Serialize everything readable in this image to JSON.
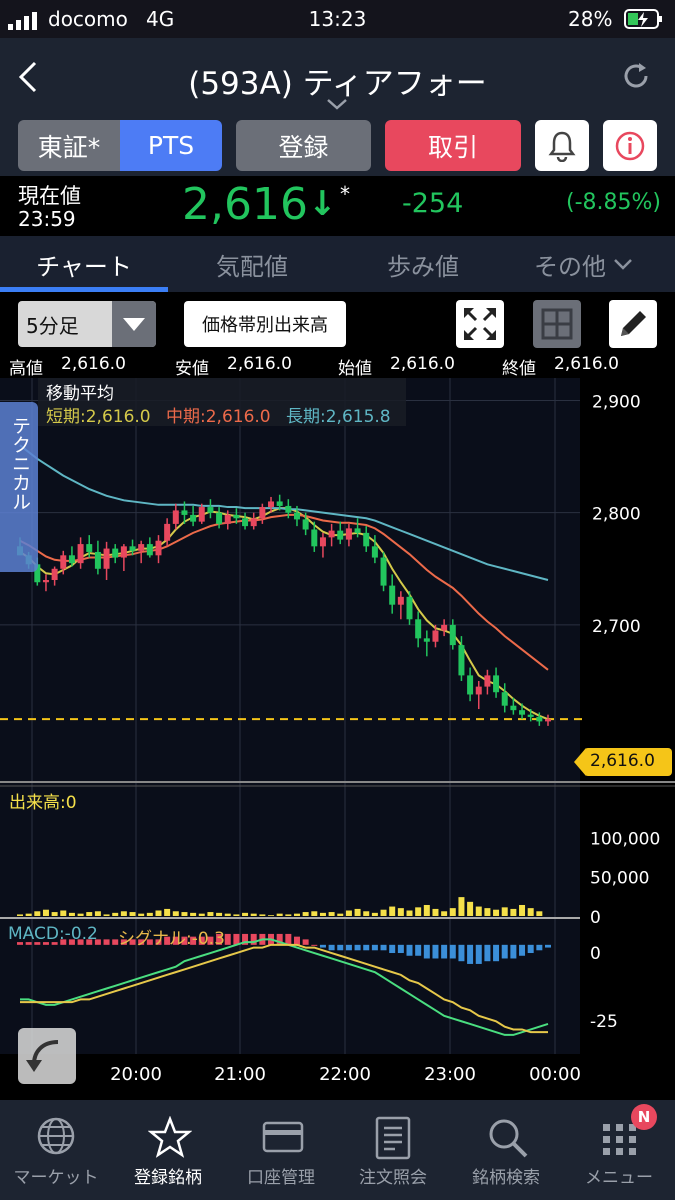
{
  "status_bar": {
    "carrier": "docomo",
    "network": "4G",
    "time": "13:23",
    "battery": "28%"
  },
  "header": {
    "title": "(593A) ティアフォー"
  },
  "buttons": {
    "tse": "東証*",
    "pts": "PTS",
    "register": "登録",
    "trade": "取引"
  },
  "price": {
    "label": "現在値",
    "time": "23:59",
    "value": "2,616",
    "direction": "↓",
    "mark": "*",
    "change": "-254",
    "change_pct": "(-8.85%)",
    "colors": {
      "value": "#22c55e",
      "change": "#22c55e"
    }
  },
  "tabs": [
    {
      "label": "チャート",
      "active": true
    },
    {
      "label": "気配値",
      "active": false
    },
    {
      "label": "歩み値",
      "active": false
    },
    {
      "label": "その他",
      "active": false
    }
  ],
  "chart_toolbar": {
    "interval": "5分足",
    "volume_profile_label": "価格帯別出来高"
  },
  "ohlc": {
    "high_label": "高値",
    "high": "2,616.0",
    "low_label": "安値",
    "low": "2,616.0",
    "open_label": "始値",
    "open": "2,616.0",
    "close_label": "終値",
    "close": "2,616.0"
  },
  "moving_avg": {
    "title": "移動平均",
    "short": "短期:2,616.0",
    "mid": "中期:2,616.0",
    "long": "長期:2,615.8",
    "colors": {
      "short": "#d4c94a",
      "mid": "#ec6a4a",
      "long": "#5fb6c4"
    }
  },
  "technical_tab": "テクニカル",
  "volume_label": "出来高:0",
  "macd": {
    "macd_label": "MACD:-0.2",
    "signal_label": "シグナル:-0.3"
  },
  "current_price_tag": "2,616.0",
  "chart_data": [
    {
      "type": "candlestick",
      "ylim": [
        2560,
        2920
      ],
      "yticks": [
        "2,900",
        "2,800",
        "2,700"
      ],
      "x_ticks": [
        "20:00",
        "21:00",
        "22:00",
        "23:00",
        "00:00"
      ],
      "current_price": 2616,
      "candles": [
        [
          2770,
          2778,
          2762,
          2762
        ],
        [
          2762,
          2765,
          2750,
          2754
        ],
        [
          2754,
          2760,
          2735,
          2738
        ],
        [
          2738,
          2745,
          2730,
          2740
        ],
        [
          2740,
          2752,
          2735,
          2750
        ],
        [
          2750,
          2766,
          2745,
          2762
        ],
        [
          2762,
          2770,
          2752,
          2755
        ],
        [
          2755,
          2778,
          2750,
          2772
        ],
        [
          2772,
          2780,
          2760,
          2765
        ],
        [
          2765,
          2775,
          2745,
          2750
        ],
        [
          2750,
          2774,
          2740,
          2768
        ],
        [
          2768,
          2772,
          2755,
          2760
        ],
        [
          2760,
          2772,
          2748,
          2770
        ],
        [
          2770,
          2776,
          2762,
          2766
        ],
        [
          2766,
          2775,
          2755,
          2772
        ],
        [
          2772,
          2778,
          2760,
          2762
        ],
        [
          2762,
          2780,
          2755,
          2775
        ],
        [
          2775,
          2795,
          2770,
          2790
        ],
        [
          2790,
          2808,
          2785,
          2802
        ],
        [
          2802,
          2810,
          2790,
          2798
        ],
        [
          2798,
          2806,
          2788,
          2792
        ],
        [
          2792,
          2808,
          2790,
          2805
        ],
        [
          2805,
          2812,
          2795,
          2800
        ],
        [
          2800,
          2805,
          2786,
          2790
        ],
        [
          2790,
          2802,
          2785,
          2798
        ],
        [
          2798,
          2804,
          2790,
          2795
        ],
        [
          2795,
          2800,
          2785,
          2788
        ],
        [
          2788,
          2800,
          2785,
          2795
        ],
        [
          2795,
          2808,
          2790,
          2805
        ],
        [
          2805,
          2814,
          2800,
          2810
        ],
        [
          2810,
          2816,
          2802,
          2806
        ],
        [
          2806,
          2812,
          2795,
          2800
        ],
        [
          2800,
          2806,
          2788,
          2794
        ],
        [
          2794,
          2800,
          2780,
          2785
        ],
        [
          2785,
          2792,
          2765,
          2770
        ],
        [
          2770,
          2782,
          2760,
          2778
        ],
        [
          2778,
          2790,
          2770,
          2784
        ],
        [
          2784,
          2792,
          2772,
          2776
        ],
        [
          2776,
          2790,
          2770,
          2786
        ],
        [
          2786,
          2795,
          2778,
          2782
        ],
        [
          2782,
          2788,
          2765,
          2770
        ],
        [
          2770,
          2780,
          2755,
          2760
        ],
        [
          2760,
          2765,
          2730,
          2735
        ],
        [
          2735,
          2745,
          2710,
          2718
        ],
        [
          2718,
          2730,
          2705,
          2725
        ],
        [
          2725,
          2730,
          2700,
          2705
        ],
        [
          2705,
          2712,
          2680,
          2688
        ],
        [
          2688,
          2695,
          2672,
          2685
        ],
        [
          2685,
          2700,
          2680,
          2695
        ],
        [
          2695,
          2705,
          2690,
          2700
        ],
        [
          2700,
          2705,
          2678,
          2682
        ],
        [
          2682,
          2690,
          2650,
          2655
        ],
        [
          2655,
          2662,
          2632,
          2638
        ],
        [
          2638,
          2650,
          2625,
          2645
        ],
        [
          2645,
          2660,
          2638,
          2655
        ],
        [
          2655,
          2662,
          2635,
          2640
        ],
        [
          2640,
          2648,
          2622,
          2628
        ],
        [
          2628,
          2635,
          2620,
          2624
        ],
        [
          2624,
          2630,
          2616,
          2620
        ],
        [
          2620,
          2625,
          2614,
          2618
        ],
        [
          2618,
          2622,
          2610,
          2614
        ],
        [
          2614,
          2620,
          2610,
          2616
        ]
      ],
      "series": [
        {
          "name": "短期",
          "values": [
            2765,
            2760,
            2752,
            2746,
            2745,
            2749,
            2753,
            2760,
            2764,
            2763,
            2762,
            2763,
            2764,
            2766,
            2768,
            2768,
            2770,
            2776,
            2785,
            2792,
            2796,
            2798,
            2801,
            2800,
            2798,
            2797,
            2796,
            2794,
            2797,
            2801,
            2804,
            2804,
            2801,
            2796,
            2789,
            2783,
            2780,
            2780,
            2781,
            2782,
            2780,
            2774,
            2764,
            2750,
            2738,
            2727,
            2714,
            2704,
            2697,
            2695,
            2692,
            2682,
            2668,
            2655,
            2650,
            2647,
            2641,
            2634,
            2628,
            2623,
            2619,
            2616
          ]
        },
        {
          "name": "中期",
          "values": [
            2775,
            2771,
            2766,
            2761,
            2758,
            2757,
            2757,
            2758,
            2760,
            2760,
            2760,
            2761,
            2762,
            2763,
            2765,
            2766,
            2767,
            2770,
            2774,
            2778,
            2782,
            2785,
            2788,
            2790,
            2791,
            2792,
            2793,
            2793,
            2794,
            2796,
            2797,
            2798,
            2798,
            2797,
            2795,
            2793,
            2792,
            2791,
            2791,
            2790,
            2789,
            2786,
            2781,
            2775,
            2769,
            2763,
            2756,
            2749,
            2743,
            2738,
            2733,
            2726,
            2718,
            2710,
            2703,
            2697,
            2690,
            2684,
            2678,
            2672,
            2666,
            2660
          ]
        },
        {
          "name": "長期",
          "values": [
            2860,
            2854,
            2848,
            2843,
            2838,
            2833,
            2829,
            2825,
            2821,
            2818,
            2815,
            2813,
            2811,
            2810,
            2809,
            2808,
            2807,
            2807,
            2807,
            2807,
            2807,
            2806,
            2806,
            2806,
            2805,
            2805,
            2804,
            2804,
            2804,
            2804,
            2804,
            2803,
            2803,
            2802,
            2801,
            2800,
            2799,
            2798,
            2797,
            2796,
            2795,
            2793,
            2790,
            2787,
            2784,
            2781,
            2778,
            2775,
            2772,
            2769,
            2766,
            2763,
            2760,
            2757,
            2754,
            2752,
            2750,
            2748,
            2746,
            2744,
            2742,
            2740
          ]
        }
      ]
    },
    {
      "type": "bar",
      "title": "出来高",
      "yticks": [
        "100,000",
        "50,000",
        "0"
      ],
      "ylim": [
        0,
        150000
      ],
      "values": [
        2000,
        3000,
        6000,
        8000,
        5000,
        7000,
        4000,
        3000,
        5000,
        6000,
        2000,
        4000,
        6000,
        5000,
        3000,
        4000,
        7000,
        9000,
        6000,
        5000,
        4000,
        3000,
        5000,
        4000,
        3000,
        2000,
        4000,
        3000,
        2000,
        1000,
        3000,
        2000,
        3000,
        5000,
        6000,
        4000,
        5000,
        3000,
        7000,
        9000,
        6000,
        4000,
        8000,
        12000,
        10000,
        7000,
        11000,
        14000,
        9000,
        6000,
        10000,
        24000,
        18000,
        12000,
        10000,
        8000,
        11000,
        9000,
        14000,
        10000,
        6000,
        0
      ]
    },
    {
      "type": "histogram+line",
      "title": "MACD",
      "yticks": [
        "0",
        "-25"
      ],
      "ylim": [
        -40,
        8
      ],
      "histogram": [
        1,
        1,
        1,
        1,
        1,
        2,
        2,
        2,
        2,
        2,
        2,
        2,
        2,
        2,
        2,
        2,
        2,
        3,
        3,
        3,
        3,
        3,
        3,
        4,
        4,
        4,
        4,
        4,
        4,
        4,
        4,
        4,
        3,
        2,
        0,
        -1,
        -2,
        -2,
        -2,
        -2,
        -2,
        -2,
        -2,
        -3,
        -3,
        -4,
        -4,
        -5,
        -5,
        -5,
        -5,
        -6,
        -7,
        -7,
        -6,
        -6,
        -5,
        -5,
        -4,
        -3,
        -2,
        -1
      ],
      "series": [
        {
          "name": "MACD",
          "values": [
            -20,
            -20,
            -21,
            -22,
            -22,
            -21,
            -20,
            -19,
            -18,
            -17,
            -16,
            -15,
            -14,
            -13,
            -12,
            -11,
            -10,
            -9,
            -8,
            -6,
            -5,
            -4,
            -3,
            -2,
            -1,
            0,
            1,
            1,
            2,
            2,
            1,
            0,
            -1,
            -2,
            -3,
            -4,
            -5,
            -6,
            -7,
            -8,
            -9,
            -10,
            -12,
            -14,
            -16,
            -18,
            -20,
            -22,
            -24,
            -26,
            -27,
            -28,
            -29,
            -30,
            -31,
            -32,
            -33,
            -33,
            -32,
            -31,
            -30,
            -29
          ]
        },
        {
          "name": "シグナル",
          "values": [
            -21,
            -21,
            -21,
            -21,
            -21,
            -21,
            -21,
            -20,
            -20,
            -19,
            -18,
            -17,
            -16,
            -15,
            -14,
            -13,
            -12,
            -11,
            -10,
            -9,
            -8,
            -7,
            -6,
            -5,
            -4,
            -3,
            -2,
            -1,
            -1,
            0,
            0,
            0,
            0,
            -1,
            -1,
            -2,
            -3,
            -4,
            -5,
            -6,
            -7,
            -8,
            -9,
            -10,
            -11,
            -13,
            -14,
            -16,
            -18,
            -20,
            -21,
            -23,
            -24,
            -26,
            -27,
            -28,
            -30,
            -31,
            -31,
            -32,
            -32,
            -32
          ]
        }
      ]
    }
  ],
  "bottom_nav": [
    {
      "label": "マーケット",
      "icon": "globe-icon"
    },
    {
      "label": "登録銘柄",
      "icon": "star-icon"
    },
    {
      "label": "口座管理",
      "icon": "card-icon"
    },
    {
      "label": "注文照会",
      "icon": "document-icon"
    },
    {
      "label": "銘柄検索",
      "icon": "search-icon"
    },
    {
      "label": "メニュー",
      "icon": "grid-icon",
      "badge": "N"
    }
  ]
}
